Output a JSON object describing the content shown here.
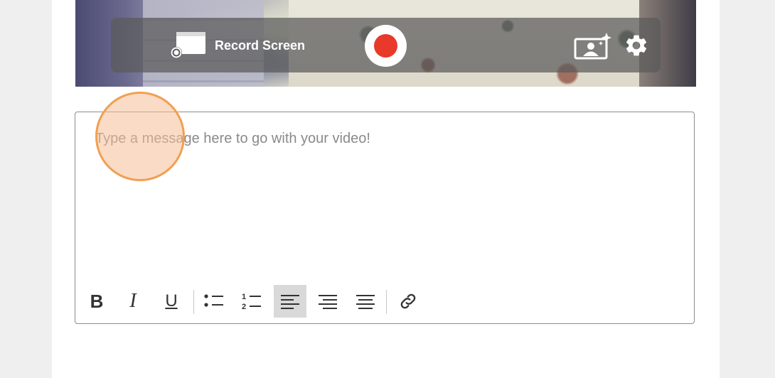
{
  "toolbar": {
    "record_screen_label": "Record Screen",
    "icons": {
      "record_screen": "screen-record-icon",
      "record": "record-dot-icon",
      "background": "virtual-background-icon",
      "settings": "gear-icon"
    },
    "record_color": "#e8392a"
  },
  "editor": {
    "placeholder": "Type a message here to go with your video!",
    "format_buttons": [
      {
        "name": "bold",
        "glyph": "B"
      },
      {
        "name": "italic",
        "glyph": "I"
      },
      {
        "name": "underline",
        "glyph": "U"
      },
      {
        "name": "bullet-list"
      },
      {
        "name": "numbered-list"
      },
      {
        "name": "align-left",
        "active": true
      },
      {
        "name": "align-center"
      },
      {
        "name": "align-right"
      },
      {
        "name": "link"
      }
    ]
  },
  "colors": {
    "click_indicator_fill": "#f6be96",
    "click_indicator_border": "#f0a052"
  }
}
